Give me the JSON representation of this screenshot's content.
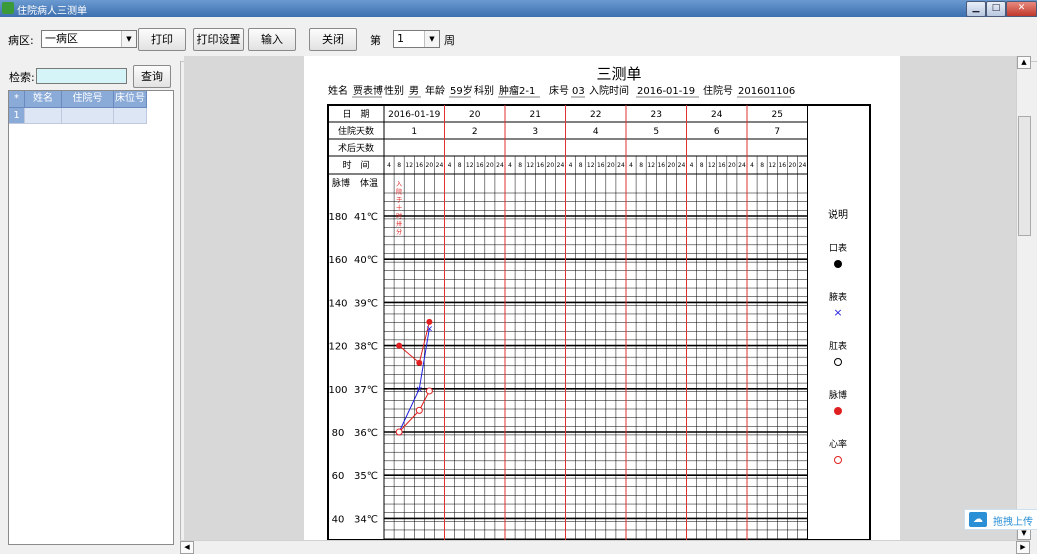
{
  "window": {
    "title": "住院病人三测单"
  },
  "toolbar": {
    "ward_label": "病区:",
    "ward_value": "一病区",
    "print_label": "打印",
    "print_settings_label": "打印设置",
    "input_label": "输入",
    "close_label": "关闭",
    "week_prefix": "第",
    "week_value": "1",
    "week_suffix": "周"
  },
  "left": {
    "search_label": "检索:",
    "search_value": "",
    "query_label": "查询",
    "columns": [
      "*",
      "姓名",
      "住院号",
      "床位号"
    ],
    "rows": [
      [
        "1",
        "",
        "",
        ""
      ]
    ]
  },
  "chart": {
    "title": "三测单",
    "patient": {
      "name_label": "姓名",
      "name": "贾表博",
      "sex_label": "性别",
      "sex": "男",
      "age_label": "年龄",
      "age": "59岁",
      "dept_label": "科别",
      "dept": "肿瘤2-1",
      "bed_label": "床号",
      "bed": "03",
      "admit_label": "入院时间",
      "admit": "2016-01-19",
      "hosp_label": "住院号",
      "hosp": "201601106"
    },
    "row_labels": {
      "date": "日　期",
      "days": "住院天数",
      "postop": "术后天数",
      "time": "时　间",
      "pulse": "脉博",
      "temp": "体温"
    },
    "dates": [
      "2016-01-19",
      "20",
      "21",
      "22",
      "23",
      "24",
      "25"
    ],
    "hospital_days": [
      "1",
      "2",
      "3",
      "4",
      "5",
      "6",
      "7"
    ],
    "hours": [
      "4",
      "8",
      "12",
      "16",
      "20",
      "24"
    ],
    "pulse_ticks": [
      "180",
      "160",
      "140",
      "120",
      "100",
      "80",
      "60",
      "40"
    ],
    "temp_ticks": [
      "41℃",
      "40℃",
      "39℃",
      "38℃",
      "37℃",
      "36℃",
      "35℃",
      "34℃"
    ],
    "annotation": "入院于十时卅分",
    "legend": {
      "title": "说明",
      "items": [
        "口表",
        "腋表",
        "肛表",
        "脉博",
        "心率"
      ]
    }
  },
  "chart_data": {
    "type": "line",
    "x_unit": "hour slot index (6 per day, starting 2016-01-19 04:00)",
    "ylabel_left": "脉博",
    "ylabel_right": "体温",
    "ylim_temp": [
      34,
      41
    ],
    "ylim_pulse": [
      40,
      180
    ],
    "series": [
      {
        "name": "口表",
        "marker": "filled-black",
        "points": []
      },
      {
        "name": "腋表",
        "marker": "blue-x",
        "points": [
          [
            1,
            36.0
          ],
          [
            3,
            37.0
          ],
          [
            4,
            38.4
          ]
        ]
      },
      {
        "name": "肛表",
        "marker": "hollow-black",
        "points": []
      },
      {
        "name": "脉博",
        "marker": "filled-red",
        "points": [
          [
            1,
            120
          ],
          [
            3,
            112
          ],
          [
            4,
            131
          ]
        ]
      },
      {
        "name": "心率",
        "marker": "hollow-red",
        "points": [
          [
            1,
            80
          ],
          [
            3,
            90
          ],
          [
            4,
            99
          ]
        ]
      }
    ]
  },
  "upload": {
    "label": "拖拽上传"
  },
  "colors": {
    "grid": "#000000",
    "day_divider": "#e03030",
    "pulse": "#e02020",
    "axillary": "#2020e0",
    "input_bg": "#d4f4f8",
    "header_bg": "#8aaad8"
  }
}
